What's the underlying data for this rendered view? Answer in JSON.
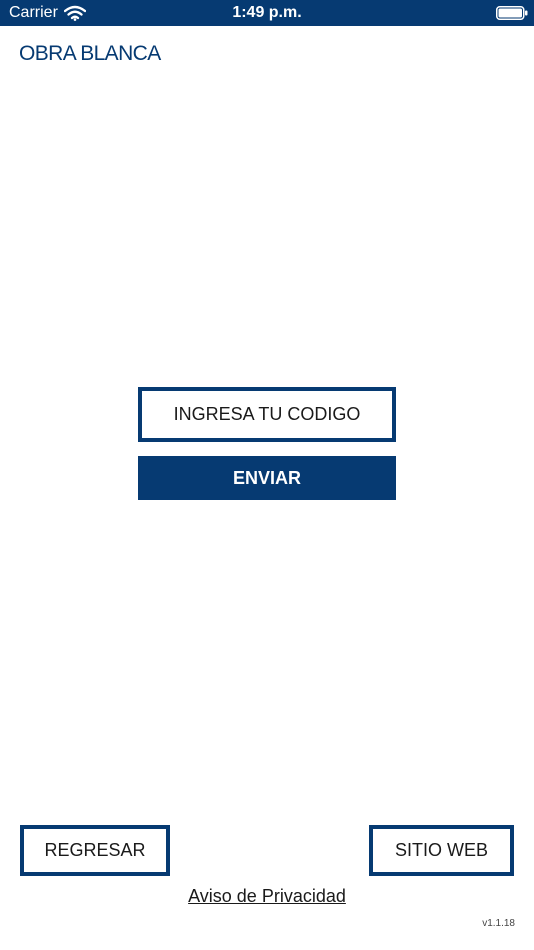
{
  "status_bar": {
    "carrier": "Carrier",
    "time": "1:49 p.m.",
    "background_color": "#063a72",
    "icons": [
      "wifi-icon",
      "battery-icon"
    ]
  },
  "brand": {
    "logo_text": "OBRA BLANCA",
    "color": "#063a72"
  },
  "code_form": {
    "code_placeholder": "INGRESA TU CODIGO",
    "code_value": "",
    "submit_label": "ENVIAR"
  },
  "footer": {
    "back_label": "REGRESAR",
    "website_label": "SITIO WEB",
    "privacy_label": "Aviso de Privacidad",
    "version": "v1.1.18"
  },
  "colors": {
    "accent": "#063a72",
    "text": "#1a1a1a",
    "background": "#ffffff"
  }
}
